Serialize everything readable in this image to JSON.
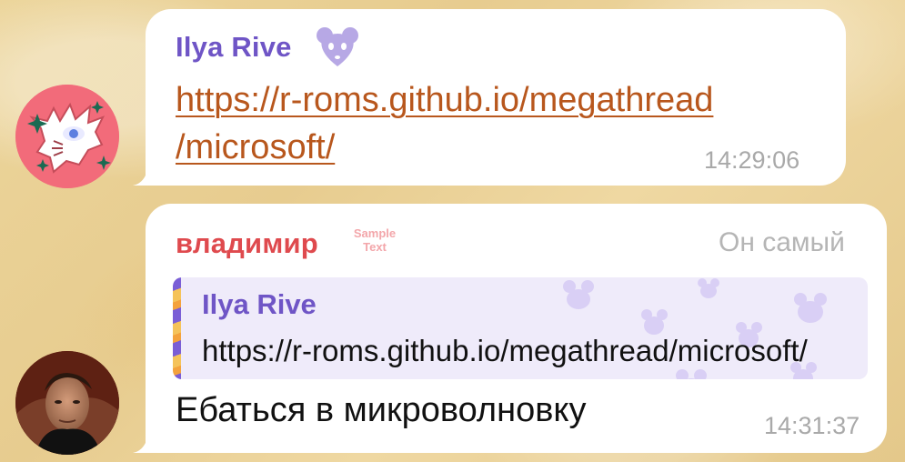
{
  "messages": [
    {
      "sender": "Ilya Rive",
      "link_line_1": "https://r-roms.github.io/megathread",
      "link_line_2": "/microsoft/",
      "time": "14:29:06",
      "avatar_icon": "rat-character-avatar",
      "status_icon": "rat-face-icon",
      "colors": {
        "sender": "#6f55c6",
        "link": "#b8571d",
        "avatar_bg": "#f26b7a"
      }
    },
    {
      "sender": "владимир",
      "badge": [
        "Sample",
        "Text"
      ],
      "title": "Он самый",
      "reply": {
        "author": "Ilya Rive",
        "text": "https://r-roms.github.io/megathread/microsoft/"
      },
      "text": "Ебаться в микроволновку",
      "time": "14:31:37",
      "avatar_icon": "user-photo-avatar",
      "colors": {
        "sender": "#df4a4e",
        "reply_bg": "#efebfa",
        "reply_author": "#6f55c6"
      }
    }
  ]
}
